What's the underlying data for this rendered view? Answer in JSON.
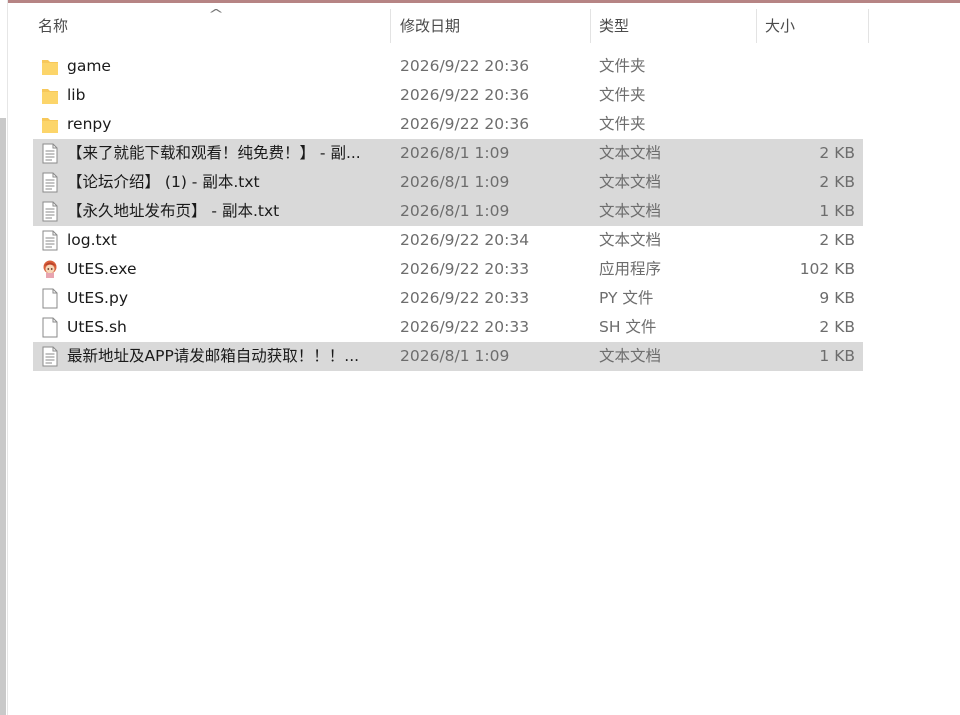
{
  "columns": {
    "name": "名称",
    "date": "修改日期",
    "type": "类型",
    "size": "大小"
  },
  "files": [
    {
      "name": "game",
      "date": "2026/9/22 20:36",
      "type": "文件夹",
      "size": "",
      "icon": "folder-icon",
      "selected": false
    },
    {
      "name": "lib",
      "date": "2026/9/22 20:36",
      "type": "文件夹",
      "size": "",
      "icon": "folder-icon",
      "selected": false
    },
    {
      "name": "renpy",
      "date": "2026/9/22 20:36",
      "type": "文件夹",
      "size": "",
      "icon": "folder-icon",
      "selected": false
    },
    {
      "name": "【来了就能下载和观看！纯免费！】 - 副...",
      "date": "2026/8/1 1:09",
      "type": "文本文档",
      "size": "2 KB",
      "icon": "text-file-icon",
      "selected": true
    },
    {
      "name": "【论坛介绍】 (1) - 副本.txt",
      "date": "2026/8/1 1:09",
      "type": "文本文档",
      "size": "2 KB",
      "icon": "text-file-icon",
      "selected": true
    },
    {
      "name": "【永久地址发布页】 - 副本.txt",
      "date": "2026/8/1 1:09",
      "type": "文本文档",
      "size": "1 KB",
      "icon": "text-file-icon",
      "selected": true
    },
    {
      "name": "log.txt",
      "date": "2026/9/22 20:34",
      "type": "文本文档",
      "size": "2 KB",
      "icon": "text-file-icon",
      "selected": false
    },
    {
      "name": "UtES.exe",
      "date": "2026/9/22 20:33",
      "type": "应用程序",
      "size": "102 KB",
      "icon": "app-icon",
      "selected": false
    },
    {
      "name": "UtES.py",
      "date": "2026/9/22 20:33",
      "type": "PY 文件",
      "size": "9 KB",
      "icon": "blank-file-icon",
      "selected": false
    },
    {
      "name": "UtES.sh",
      "date": "2026/9/22 20:33",
      "type": "SH 文件",
      "size": "2 KB",
      "icon": "blank-file-icon",
      "selected": false
    },
    {
      "name": "最新地址及APP请发邮箱自动获取！！！...",
      "date": "2026/8/1 1:09",
      "type": "文本文档",
      "size": "1 KB",
      "icon": "text-file-icon",
      "selected": true
    }
  ],
  "colors": {
    "selection": "#d9d9d9",
    "folder": "#f7c85a",
    "header_text": "#4b4b4b",
    "meta_text": "#6d6d6d"
  }
}
